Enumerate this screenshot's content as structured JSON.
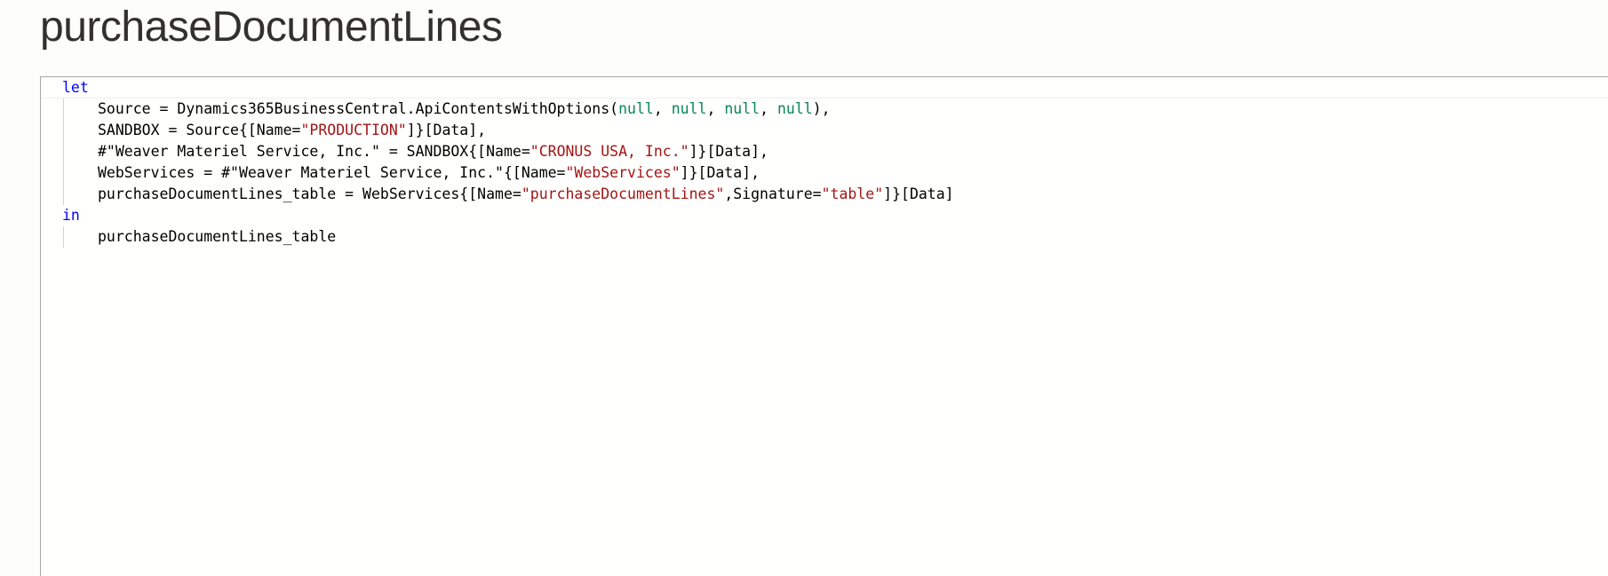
{
  "title": "purchaseDocumentLines",
  "code": {
    "line1": {
      "kw": "let"
    },
    "line2": {
      "prefix": "Source = Dynamics365BusinessCentral.ApiContentsWithOptions(",
      "null1": "null",
      "sep1": ", ",
      "null2": "null",
      "sep2": ", ",
      "null3": "null",
      "sep3": ", ",
      "null4": "null",
      "suffix": "),"
    },
    "line3": {
      "prefix": "SANDBOX = Source{[Name=",
      "str": "\"PRODUCTION\"",
      "suffix": "]}[Data],"
    },
    "line4": {
      "prefix": "#\"Weaver Materiel Service, Inc.\" = SANDBOX{[Name=",
      "str": "\"CRONUS USA, Inc.\"",
      "suffix": "]}[Data],"
    },
    "line5": {
      "prefix": "WebServices = #\"Weaver Materiel Service, Inc.\"{[Name=",
      "str": "\"WebServices\"",
      "suffix": "]}[Data],"
    },
    "line6": {
      "prefix": "purchaseDocumentLines_table = WebServices{[Name=",
      "str1": "\"purchaseDocumentLines\"",
      "mid": ",Signature=",
      "str2": "\"table\"",
      "suffix": "]}[Data]"
    },
    "line7": {
      "kw": "in"
    },
    "line8": {
      "text": "purchaseDocumentLines_table"
    }
  },
  "colors": {
    "keyword": "#0000ff",
    "literal": "#098658",
    "string": "#a31515",
    "text": "#000000"
  }
}
